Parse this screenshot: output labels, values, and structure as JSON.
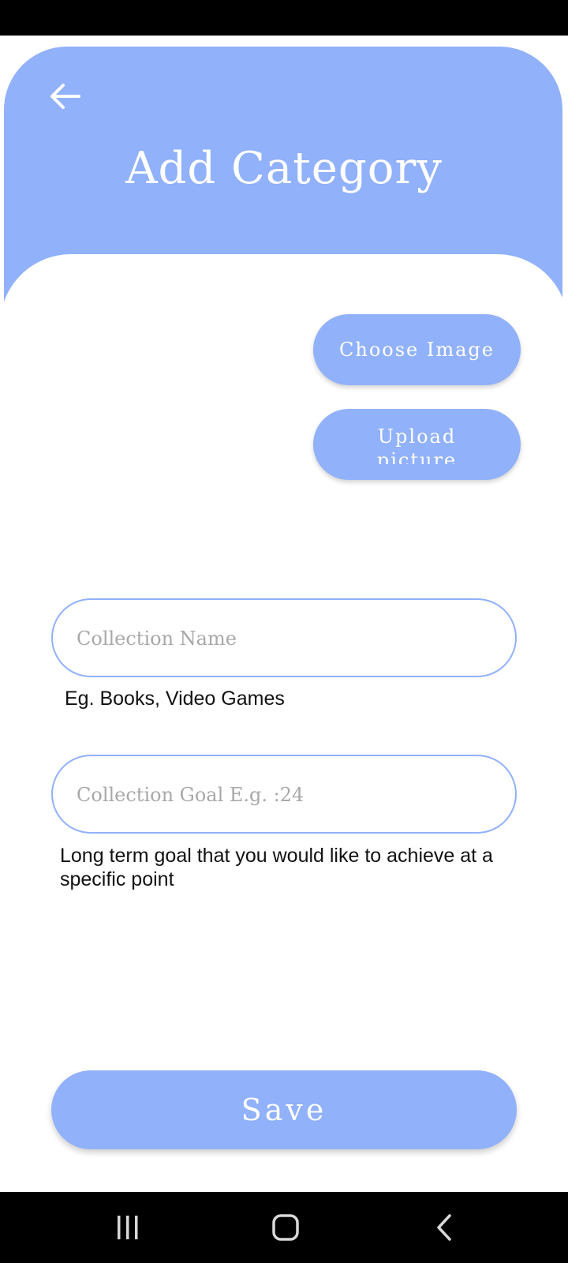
{
  "header": {
    "title": "Add Category",
    "back_icon": "arrow-left-icon"
  },
  "image_actions": {
    "choose_label": "Choose Image",
    "upload_label": "Upload picture"
  },
  "form": {
    "collection_name": {
      "placeholder": "Collection Name",
      "value": "",
      "helper": "Eg. Books, Video Games"
    },
    "collection_goal": {
      "placeholder": "Collection Goal E.g. :24",
      "value": "",
      "helper": "Long term goal that you would like to achieve at a specific point"
    }
  },
  "save_label": "Save",
  "navigation": {
    "recents_icon": "recents-icon",
    "home_icon": "home-icon",
    "back_icon": "back-chevron-icon"
  },
  "colors": {
    "accent": "#91b1fa",
    "background": "#ffffff",
    "system_bars": "#000000"
  }
}
